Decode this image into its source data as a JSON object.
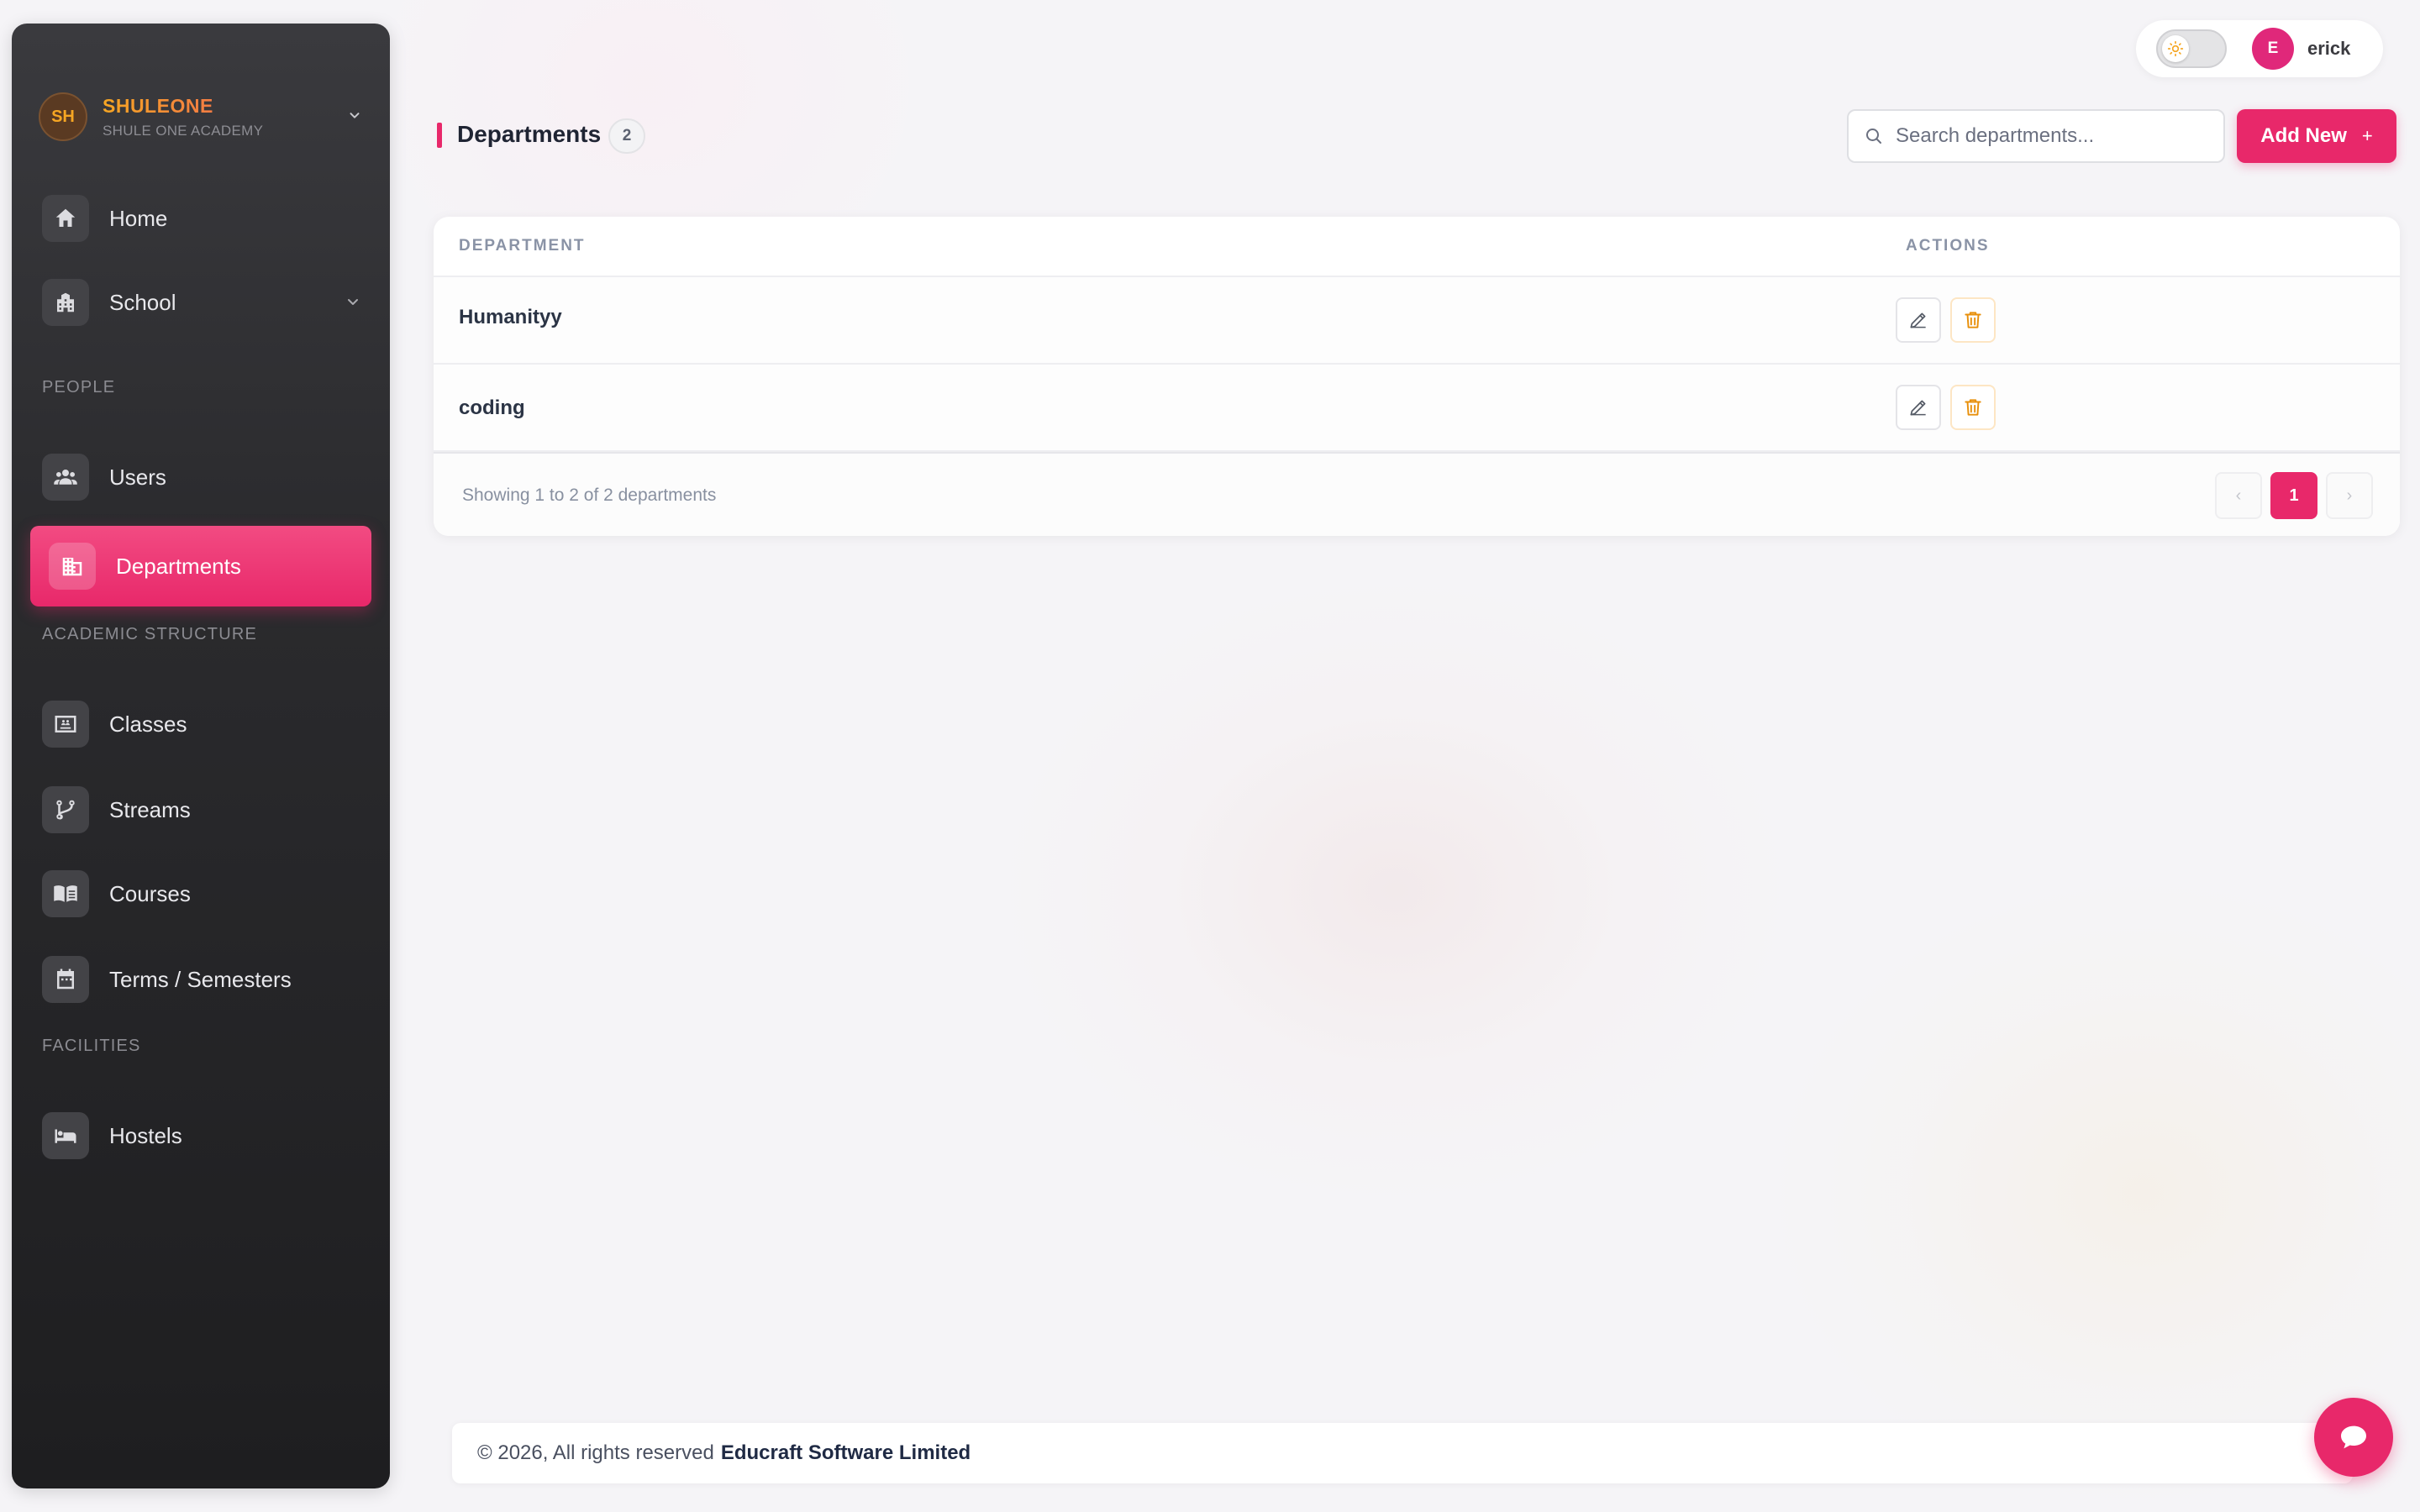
{
  "brand": {
    "initials": "SH",
    "name": "SHULEONE",
    "subtitle": "SHULE ONE ACADEMY"
  },
  "sidebar": {
    "items": [
      {
        "label": "Home",
        "icon": "home-icon"
      },
      {
        "label": "School",
        "icon": "building-icon"
      }
    ],
    "sections": [
      {
        "label": "PEOPLE",
        "items": [
          {
            "label": "Users",
            "icon": "users-icon"
          },
          {
            "label": "Departments",
            "icon": "departments-icon",
            "active": true
          }
        ]
      },
      {
        "label": "ACADEMIC STRUCTURE",
        "items": [
          {
            "label": "Classes",
            "icon": "classes-icon"
          },
          {
            "label": "Streams",
            "icon": "streams-icon"
          },
          {
            "label": "Courses",
            "icon": "book-icon"
          },
          {
            "label": "Terms / Semesters",
            "icon": "calendar-icon"
          }
        ]
      },
      {
        "label": "FACILITIES",
        "items": [
          {
            "label": "Hostels",
            "icon": "bed-icon"
          }
        ]
      }
    ]
  },
  "topbar": {
    "user_initial": "E",
    "user_name": "erick",
    "theme": "light"
  },
  "page": {
    "title": "Departments",
    "count": "2",
    "search_placeholder": "Search departments...",
    "add_label": "Add New",
    "add_plus": "+"
  },
  "table": {
    "columns": [
      "DEPARTMENT",
      "ACTIONS"
    ],
    "rows": [
      {
        "name": "Humanityy"
      },
      {
        "name": "coding"
      }
    ],
    "showing": "Showing 1 to 2 of 2 departments",
    "pagination": {
      "prev": "‹",
      "current": "1",
      "next": "›"
    }
  },
  "footer": {
    "text": "© 2026, All rights reserved",
    "company": "Educraft Software Limited"
  },
  "colors": {
    "accent": "#e8286a",
    "sidebar": "#2b2b2e",
    "brand_gradient_start": "#f6a623",
    "delete": "#e8900c"
  }
}
